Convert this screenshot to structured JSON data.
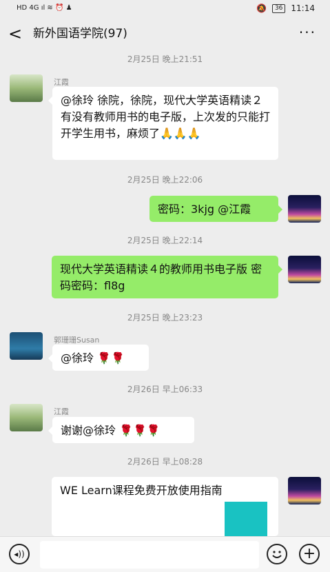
{
  "status_bar": {
    "left": "HD 4G ıl ≋ ⏰ ♟",
    "battery": "36",
    "time": "11:14"
  },
  "header": {
    "back": "<",
    "title": "新外国语学院(97)",
    "more": "···"
  },
  "messages": [
    {
      "timestamp": "2月25日 晚上21:51",
      "sender": "江霞",
      "direction": "in",
      "text": "@徐玲  徐院，徐院，现代大学英语精读２有没有教师用书的电子版，上次发的只能打开学生用书，麻烦了🙏🙏🙏"
    },
    {
      "timestamp": "2月25日 晚上22:06",
      "direction": "out",
      "text": "密码：3kjg @江霞"
    },
    {
      "timestamp": "2月25日 晚上22:14",
      "direction": "out",
      "text": "现代大学英语精读４的教师用书电子版  密码密码：fl8g"
    },
    {
      "timestamp": "2月25日 晚上23:23",
      "sender": "郭珊珊Susan",
      "direction": "in",
      "text": "@徐玲  🌹🌹"
    },
    {
      "timestamp": "2月26日 早上06:33",
      "sender": "江霞",
      "direction": "in",
      "text": "谢谢@徐玲  🌹🌹🌹"
    },
    {
      "timestamp": "2月26日 早上08:28",
      "direction": "out",
      "text": "WE Learn课程免费开放使用指南"
    }
  ],
  "input_bar": {
    "placeholder": "",
    "plus": "+"
  },
  "colors": {
    "background": "#ededed",
    "out_bubble": "#95ec69",
    "in_bubble": "#ffffff"
  }
}
